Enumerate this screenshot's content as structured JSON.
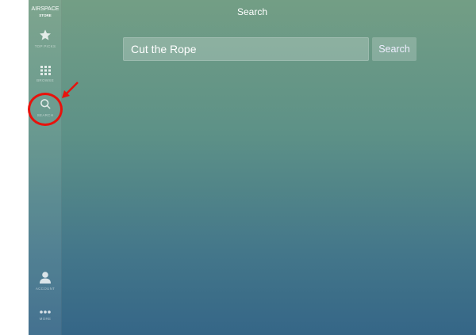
{
  "sidebar": {
    "logo_line1": "AIRSPACE",
    "logo_line2": "STORE",
    "items": [
      {
        "label": "TOP PICKS",
        "icon": "star-icon"
      },
      {
        "label": "BROWSE",
        "icon": "grid-icon"
      },
      {
        "label": "SEARCH",
        "icon": "search-icon"
      },
      {
        "label": "ACCOUNT",
        "icon": "person-icon"
      },
      {
        "label": "MORE",
        "icon": "more-dots-icon"
      }
    ]
  },
  "header": {
    "title": "Search"
  },
  "search": {
    "value": "Cut the Rope",
    "button_label": "Search"
  },
  "annotation": {
    "color": "#e8120c"
  }
}
